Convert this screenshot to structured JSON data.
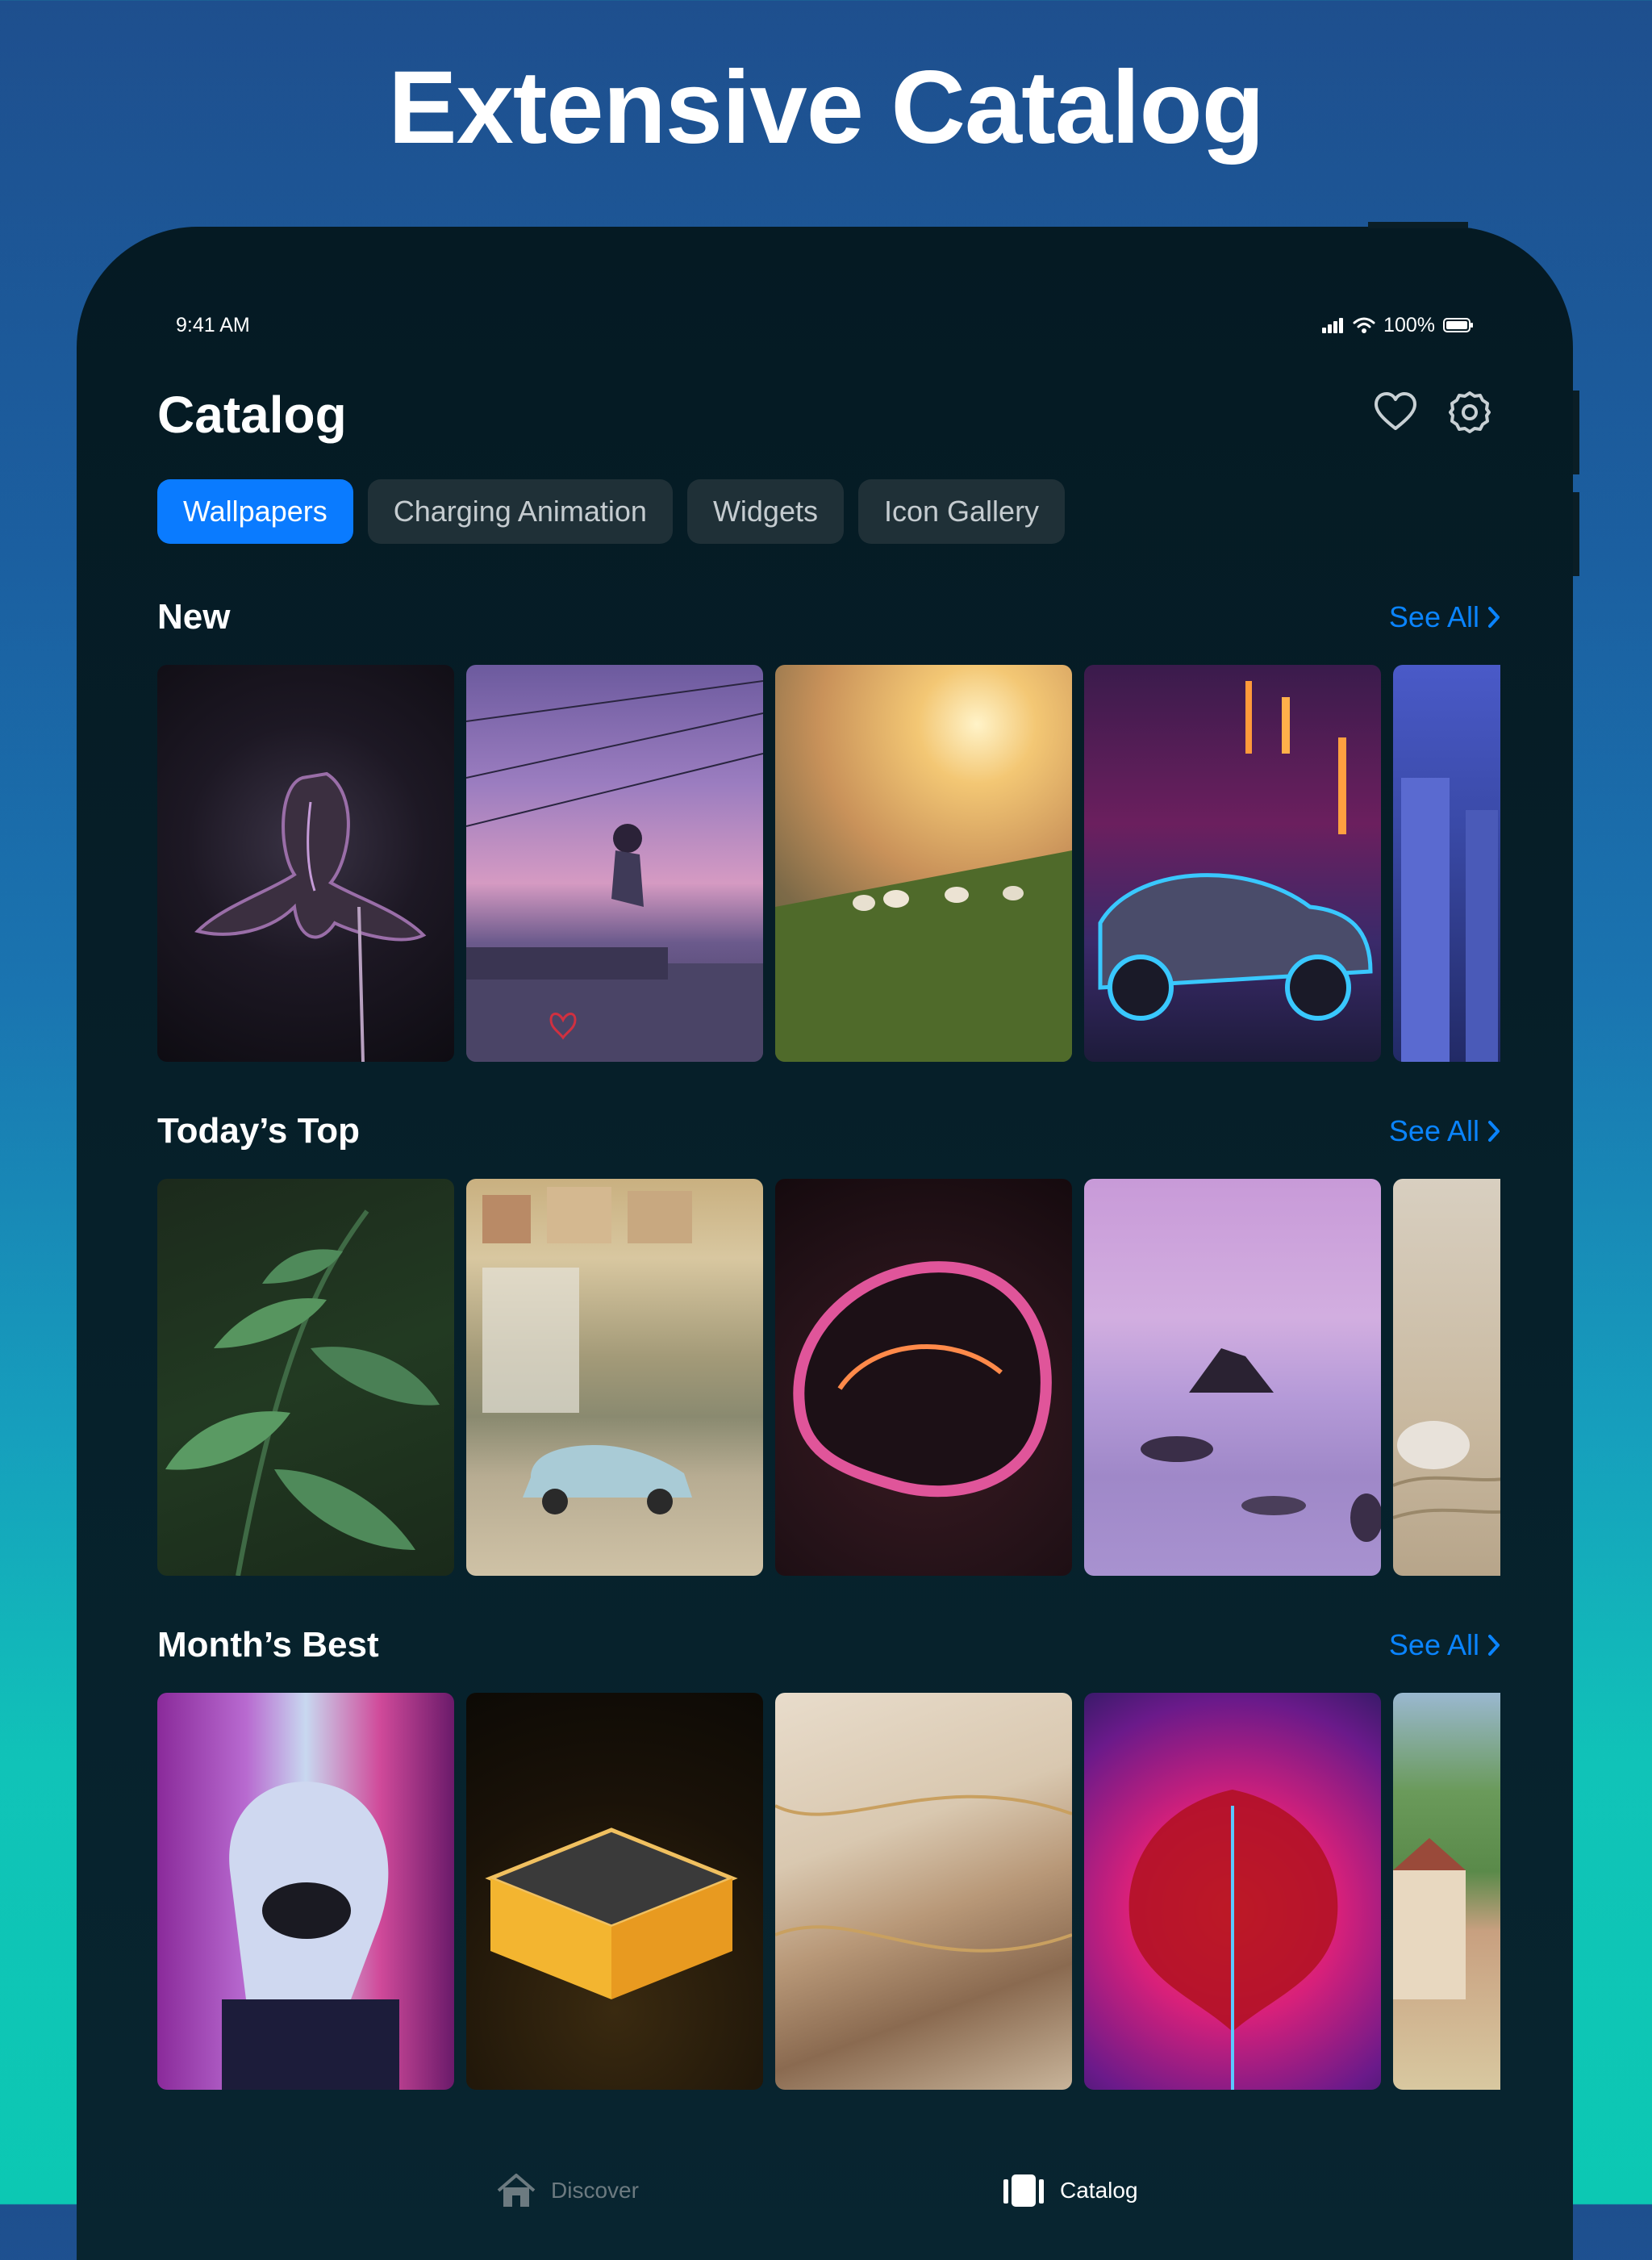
{
  "headline": "Extensive Catalog",
  "status_bar": {
    "time": "9:41 AM",
    "battery": "100%"
  },
  "header": {
    "title": "Catalog"
  },
  "tabs": [
    {
      "label": "Wallpapers"
    },
    {
      "label": "Charging Animation"
    },
    {
      "label": "Widgets"
    },
    {
      "label": "Icon Gallery"
    }
  ],
  "sections": [
    {
      "title": "New",
      "see_all": "See All"
    },
    {
      "title": "Today’s Top",
      "see_all": "See All"
    },
    {
      "title": "Month’s Best",
      "see_all": "See All"
    }
  ],
  "tab_bar": {
    "discover": "Discover",
    "catalog": "Catalog"
  },
  "colors": {
    "accent": "#0a84ff",
    "active_tab": "#0a7bff",
    "panel": "#051a23"
  },
  "icons": [
    "signal-icon",
    "wifi-icon",
    "battery-icon",
    "heart-icon",
    "gear-icon",
    "chevron-right-icon",
    "home-icon",
    "catalog-icon"
  ]
}
